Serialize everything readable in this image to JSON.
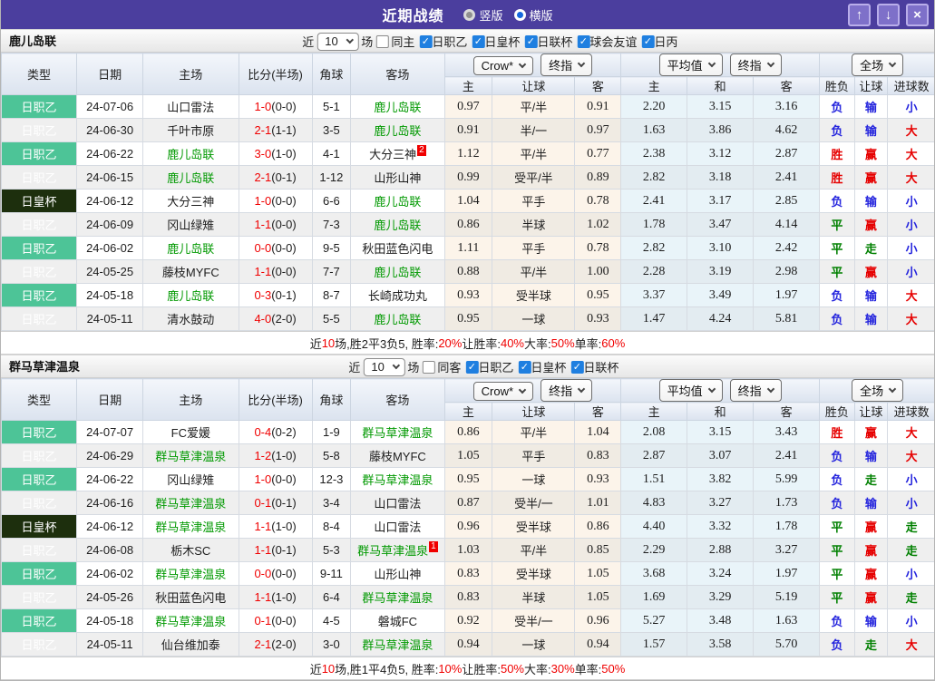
{
  "titlebar": {
    "title": "近期战绩",
    "radios": [
      {
        "label": "竖版",
        "selected": false
      },
      {
        "label": "横版",
        "selected": true
      }
    ],
    "buttons": [
      {
        "name": "move-up-button",
        "icon": "up-arrow-icon",
        "glyph": "↑"
      },
      {
        "name": "move-down-button",
        "icon": "down-arrow-icon",
        "glyph": "↓"
      },
      {
        "name": "close-button",
        "icon": "close-icon",
        "glyph": "×"
      }
    ]
  },
  "colors": {
    "titlebar_bg": "#4b3e9e",
    "type_league_green": "#4dc497",
    "type_cup_dark": "#1d2f0d",
    "team_link_green": "#009900",
    "win_red": "#e60000",
    "lose_blue": "#2424dd",
    "draw_green": "#008000",
    "score_red": "#f00000",
    "checkbox_blue": "#1f7fe0"
  },
  "table_header": {
    "static": [
      "类型",
      "日期",
      "主场",
      "比分(半场)",
      "角球",
      "客场"
    ],
    "groups": [
      {
        "dropdowns": [
          "Crow*",
          "终指"
        ],
        "subs": [
          "主",
          "让球",
          "客"
        ]
      },
      {
        "dropdowns": [
          "平均值",
          "终指"
        ],
        "subs": [
          "主",
          "和",
          "客"
        ]
      },
      {
        "dropdowns": [
          "全场"
        ],
        "subs": [
          "胜负",
          "让球",
          "进球数"
        ]
      }
    ]
  },
  "sections": [
    {
      "team": "鹿儿岛联",
      "filter": {
        "prefix": "近",
        "count": "10",
        "suffix": "场",
        "same": {
          "label": "同主",
          "checked": false
        },
        "leagues": [
          "日职乙",
          "日皇杯",
          "日联杯",
          "球会友谊",
          "日丙"
        ]
      },
      "rows": [
        {
          "type": "日职乙",
          "cup": false,
          "date": "24-07-06",
          "home": "山口雷法",
          "home_hl": false,
          "home_sup": "",
          "score": "1-0",
          "half": "(0-0)",
          "corners": "5-1",
          "away": "鹿儿岛联",
          "away_hl": true,
          "away_sup": "",
          "crow": [
            "0.97",
            "平/半",
            "0.91"
          ],
          "avg": [
            "2.20",
            "3.15",
            "3.16"
          ],
          "res": [
            [
              "负",
              "b"
            ],
            [
              "输",
              "b"
            ],
            [
              "小",
              "b"
            ]
          ]
        },
        {
          "type": "日职乙",
          "cup": false,
          "date": "24-06-30",
          "home": "千叶市原",
          "home_hl": false,
          "home_sup": "",
          "score": "2-1",
          "half": "(1-1)",
          "corners": "3-5",
          "away": "鹿儿岛联",
          "away_hl": true,
          "away_sup": "",
          "crow": [
            "0.91",
            "半/一",
            "0.97"
          ],
          "avg": [
            "1.63",
            "3.86",
            "4.62"
          ],
          "res": [
            [
              "负",
              "b"
            ],
            [
              "输",
              "b"
            ],
            [
              "大",
              "r"
            ]
          ]
        },
        {
          "type": "日职乙",
          "cup": false,
          "date": "24-06-22",
          "home": "鹿儿岛联",
          "home_hl": true,
          "home_sup": "",
          "score": "3-0",
          "half": "(1-0)",
          "corners": "4-1",
          "away": "大分三神",
          "away_hl": false,
          "away_sup": "2",
          "crow": [
            "1.12",
            "平/半",
            "0.77"
          ],
          "avg": [
            "2.38",
            "3.12",
            "2.87"
          ],
          "res": [
            [
              "胜",
              "r"
            ],
            [
              "赢",
              "r"
            ],
            [
              "大",
              "r"
            ]
          ]
        },
        {
          "type": "日职乙",
          "cup": false,
          "date": "24-06-15",
          "home": "鹿儿岛联",
          "home_hl": true,
          "home_sup": "",
          "score": "2-1",
          "half": "(0-1)",
          "corners": "1-12",
          "away": "山形山神",
          "away_hl": false,
          "away_sup": "",
          "crow": [
            "0.99",
            "受平/半",
            "0.89"
          ],
          "avg": [
            "2.82",
            "3.18",
            "2.41"
          ],
          "res": [
            [
              "胜",
              "r"
            ],
            [
              "赢",
              "r"
            ],
            [
              "大",
              "r"
            ]
          ]
        },
        {
          "type": "日皇杯",
          "cup": true,
          "date": "24-06-12",
          "home": "大分三神",
          "home_hl": false,
          "home_sup": "",
          "score": "1-0",
          "half": "(0-0)",
          "corners": "6-6",
          "away": "鹿儿岛联",
          "away_hl": true,
          "away_sup": "",
          "crow": [
            "1.04",
            "平手",
            "0.78"
          ],
          "avg": [
            "2.41",
            "3.17",
            "2.85"
          ],
          "res": [
            [
              "负",
              "b"
            ],
            [
              "输",
              "b"
            ],
            [
              "小",
              "b"
            ]
          ]
        },
        {
          "type": "日职乙",
          "cup": false,
          "date": "24-06-09",
          "home": "冈山绿雉",
          "home_hl": false,
          "home_sup": "",
          "score": "1-1",
          "half": "(0-0)",
          "corners": "7-3",
          "away": "鹿儿岛联",
          "away_hl": true,
          "away_sup": "",
          "crow": [
            "0.86",
            "半球",
            "1.02"
          ],
          "avg": [
            "1.78",
            "3.47",
            "4.14"
          ],
          "res": [
            [
              "平",
              "g"
            ],
            [
              "赢",
              "r"
            ],
            [
              "小",
              "b"
            ]
          ]
        },
        {
          "type": "日职乙",
          "cup": false,
          "date": "24-06-02",
          "home": "鹿儿岛联",
          "home_hl": true,
          "home_sup": "",
          "score": "0-0",
          "half": "(0-0)",
          "corners": "9-5",
          "away": "秋田蓝色闪电",
          "away_hl": false,
          "away_sup": "",
          "crow": [
            "1.11",
            "平手",
            "0.78"
          ],
          "avg": [
            "2.82",
            "3.10",
            "2.42"
          ],
          "res": [
            [
              "平",
              "g"
            ],
            [
              "走",
              "g"
            ],
            [
              "小",
              "b"
            ]
          ]
        },
        {
          "type": "日职乙",
          "cup": false,
          "date": "24-05-25",
          "home": "藤枝MYFC",
          "home_hl": false,
          "home_sup": "",
          "score": "1-1",
          "half": "(0-0)",
          "corners": "7-7",
          "away": "鹿儿岛联",
          "away_hl": true,
          "away_sup": "",
          "crow": [
            "0.88",
            "平/半",
            "1.00"
          ],
          "avg": [
            "2.28",
            "3.19",
            "2.98"
          ],
          "res": [
            [
              "平",
              "g"
            ],
            [
              "赢",
              "r"
            ],
            [
              "小",
              "b"
            ]
          ]
        },
        {
          "type": "日职乙",
          "cup": false,
          "date": "24-05-18",
          "home": "鹿儿岛联",
          "home_hl": true,
          "home_sup": "",
          "score": "0-3",
          "half": "(0-1)",
          "corners": "8-7",
          "away": "长崎成功丸",
          "away_hl": false,
          "away_sup": "",
          "crow": [
            "0.93",
            "受半球",
            "0.95"
          ],
          "avg": [
            "3.37",
            "3.49",
            "1.97"
          ],
          "res": [
            [
              "负",
              "b"
            ],
            [
              "输",
              "b"
            ],
            [
              "大",
              "r"
            ]
          ]
        },
        {
          "type": "日职乙",
          "cup": false,
          "date": "24-05-11",
          "home": "清水鼓动",
          "home_hl": false,
          "home_sup": "",
          "score": "4-0",
          "half": "(2-0)",
          "corners": "5-5",
          "away": "鹿儿岛联",
          "away_hl": true,
          "away_sup": "",
          "crow": [
            "0.95",
            "一球",
            "0.93"
          ],
          "avg": [
            "1.47",
            "4.24",
            "5.81"
          ],
          "res": [
            [
              "负",
              "b"
            ],
            [
              "输",
              "b"
            ],
            [
              "大",
              "r"
            ]
          ]
        }
      ],
      "summary": [
        [
          "近",
          "k"
        ],
        [
          "10",
          "r"
        ],
        [
          "场,胜2平3负5, 胜率:",
          "k"
        ],
        [
          "20%",
          "r"
        ],
        [
          " 让胜率:",
          "k"
        ],
        [
          "40%",
          "r"
        ],
        [
          " 大率:",
          "k"
        ],
        [
          "50%",
          "r"
        ],
        [
          " 单率:",
          "k"
        ],
        [
          "60%",
          "r"
        ]
      ]
    },
    {
      "team": "群马草津温泉",
      "filter": {
        "prefix": "近",
        "count": "10",
        "suffix": "场",
        "same": {
          "label": "同客",
          "checked": false
        },
        "leagues": [
          "日职乙",
          "日皇杯",
          "日联杯"
        ]
      },
      "rows": [
        {
          "type": "日职乙",
          "cup": false,
          "date": "24-07-07",
          "home": "FC爱媛",
          "home_hl": false,
          "home_sup": "",
          "score": "0-4",
          "half": "(0-2)",
          "corners": "1-9",
          "away": "群马草津温泉",
          "away_hl": true,
          "away_sup": "",
          "crow": [
            "0.86",
            "平/半",
            "1.04"
          ],
          "avg": [
            "2.08",
            "3.15",
            "3.43"
          ],
          "res": [
            [
              "胜",
              "r"
            ],
            [
              "赢",
              "r"
            ],
            [
              "大",
              "r"
            ]
          ]
        },
        {
          "type": "日职乙",
          "cup": false,
          "date": "24-06-29",
          "home": "群马草津温泉",
          "home_hl": true,
          "home_sup": "",
          "score": "1-2",
          "half": "(1-0)",
          "corners": "5-8",
          "away": "藤枝MYFC",
          "away_hl": false,
          "away_sup": "",
          "crow": [
            "1.05",
            "平手",
            "0.83"
          ],
          "avg": [
            "2.87",
            "3.07",
            "2.41"
          ],
          "res": [
            [
              "负",
              "b"
            ],
            [
              "输",
              "b"
            ],
            [
              "大",
              "r"
            ]
          ]
        },
        {
          "type": "日职乙",
          "cup": false,
          "date": "24-06-22",
          "home": "冈山绿雉",
          "home_hl": false,
          "home_sup": "",
          "score": "1-0",
          "half": "(0-0)",
          "corners": "12-3",
          "away": "群马草津温泉",
          "away_hl": true,
          "away_sup": "",
          "crow": [
            "0.95",
            "一球",
            "0.93"
          ],
          "avg": [
            "1.51",
            "3.82",
            "5.99"
          ],
          "res": [
            [
              "负",
              "b"
            ],
            [
              "走",
              "g"
            ],
            [
              "小",
              "b"
            ]
          ]
        },
        {
          "type": "日职乙",
          "cup": false,
          "date": "24-06-16",
          "home": "群马草津温泉",
          "home_hl": true,
          "home_sup": "",
          "score": "0-1",
          "half": "(0-1)",
          "corners": "3-4",
          "away": "山口雷法",
          "away_hl": false,
          "away_sup": "",
          "crow": [
            "0.87",
            "受半/一",
            "1.01"
          ],
          "avg": [
            "4.83",
            "3.27",
            "1.73"
          ],
          "res": [
            [
              "负",
              "b"
            ],
            [
              "输",
              "b"
            ],
            [
              "小",
              "b"
            ]
          ]
        },
        {
          "type": "日皇杯",
          "cup": true,
          "date": "24-06-12",
          "home": "群马草津温泉",
          "home_hl": true,
          "home_sup": "",
          "score": "1-1",
          "half": "(1-0)",
          "corners": "8-4",
          "away": "山口雷法",
          "away_hl": false,
          "away_sup": "",
          "crow": [
            "0.96",
            "受半球",
            "0.86"
          ],
          "avg": [
            "4.40",
            "3.32",
            "1.78"
          ],
          "res": [
            [
              "平",
              "g"
            ],
            [
              "赢",
              "r"
            ],
            [
              "走",
              "g"
            ]
          ]
        },
        {
          "type": "日职乙",
          "cup": false,
          "date": "24-06-08",
          "home": "栃木SC",
          "home_hl": false,
          "home_sup": "",
          "score": "1-1",
          "half": "(0-1)",
          "corners": "5-3",
          "away": "群马草津温泉",
          "away_hl": true,
          "away_sup": "1",
          "crow": [
            "1.03",
            "平/半",
            "0.85"
          ],
          "avg": [
            "2.29",
            "2.88",
            "3.27"
          ],
          "res": [
            [
              "平",
              "g"
            ],
            [
              "赢",
              "r"
            ],
            [
              "走",
              "g"
            ]
          ]
        },
        {
          "type": "日职乙",
          "cup": false,
          "date": "24-06-02",
          "home": "群马草津温泉",
          "home_hl": true,
          "home_sup": "",
          "score": "0-0",
          "half": "(0-0)",
          "corners": "9-11",
          "away": "山形山神",
          "away_hl": false,
          "away_sup": "",
          "crow": [
            "0.83",
            "受半球",
            "1.05"
          ],
          "avg": [
            "3.68",
            "3.24",
            "1.97"
          ],
          "res": [
            [
              "平",
              "g"
            ],
            [
              "赢",
              "r"
            ],
            [
              "小",
              "b"
            ]
          ]
        },
        {
          "type": "日职乙",
          "cup": false,
          "date": "24-05-26",
          "home": "秋田蓝色闪电",
          "home_hl": false,
          "home_sup": "",
          "score": "1-1",
          "half": "(1-0)",
          "corners": "6-4",
          "away": "群马草津温泉",
          "away_hl": true,
          "away_sup": "",
          "crow": [
            "0.83",
            "半球",
            "1.05"
          ],
          "avg": [
            "1.69",
            "3.29",
            "5.19"
          ],
          "res": [
            [
              "平",
              "g"
            ],
            [
              "赢",
              "r"
            ],
            [
              "走",
              "g"
            ]
          ]
        },
        {
          "type": "日职乙",
          "cup": false,
          "date": "24-05-18",
          "home": "群马草津温泉",
          "home_hl": true,
          "home_sup": "",
          "score": "0-1",
          "half": "(0-0)",
          "corners": "4-5",
          "away": "磐城FC",
          "away_hl": false,
          "away_sup": "",
          "crow": [
            "0.92",
            "受半/一",
            "0.96"
          ],
          "avg": [
            "5.27",
            "3.48",
            "1.63"
          ],
          "res": [
            [
              "负",
              "b"
            ],
            [
              "输",
              "b"
            ],
            [
              "小",
              "b"
            ]
          ]
        },
        {
          "type": "日职乙",
          "cup": false,
          "date": "24-05-11",
          "home": "仙台维加泰",
          "home_hl": false,
          "home_sup": "",
          "score": "2-1",
          "half": "(2-0)",
          "corners": "3-0",
          "away": "群马草津温泉",
          "away_hl": true,
          "away_sup": "",
          "crow": [
            "0.94",
            "一球",
            "0.94"
          ],
          "avg": [
            "1.57",
            "3.58",
            "5.70"
          ],
          "res": [
            [
              "负",
              "b"
            ],
            [
              "走",
              "g"
            ],
            [
              "大",
              "r"
            ]
          ]
        }
      ],
      "summary": [
        [
          "近",
          "k"
        ],
        [
          "10",
          "r"
        ],
        [
          "场,胜1平4负5, 胜率:",
          "k"
        ],
        [
          "10%",
          "r"
        ],
        [
          " 让胜率:",
          "k"
        ],
        [
          "50%",
          "r"
        ],
        [
          " 大率:",
          "k"
        ],
        [
          "30%",
          "r"
        ],
        [
          " 单率:",
          "k"
        ],
        [
          "50%",
          "r"
        ]
      ]
    }
  ]
}
